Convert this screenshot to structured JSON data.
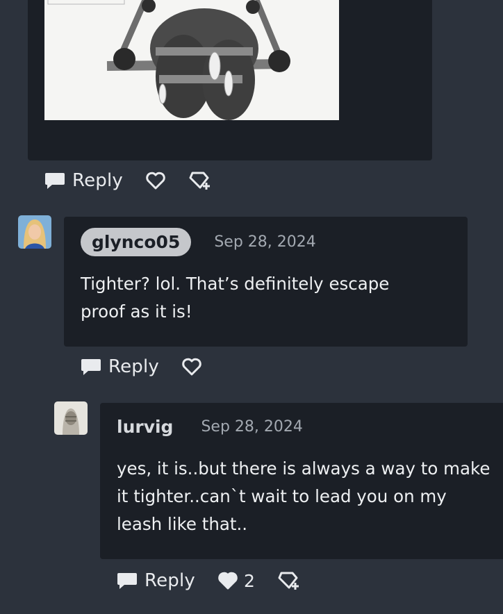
{
  "post": {
    "reply_label": "Reply"
  },
  "comments": [
    {
      "username": "glynco05",
      "date": "Sep 28, 2024",
      "body_lines": [
        "Tighter?  lol.  That’s definitely escape",
        "proof as it is!"
      ],
      "reply_label": "Reply"
    },
    {
      "username": "lurvig",
      "date": "Sep 28, 2024",
      "body_lines": [
        "yes, it is..but there is always a way to make",
        "it tighter..can`t wait to lead you on my",
        "leash like that.."
      ],
      "reply_label": "Reply",
      "like_count": "2"
    }
  ],
  "icons": {
    "reply": "speech-bubble-icon",
    "like": "heart-icon",
    "gift": "gift-icon"
  },
  "colors": {
    "page_bg": "#2c323c",
    "card_bg": "#1b1f26",
    "pill_bg": "#c5c7cb"
  }
}
